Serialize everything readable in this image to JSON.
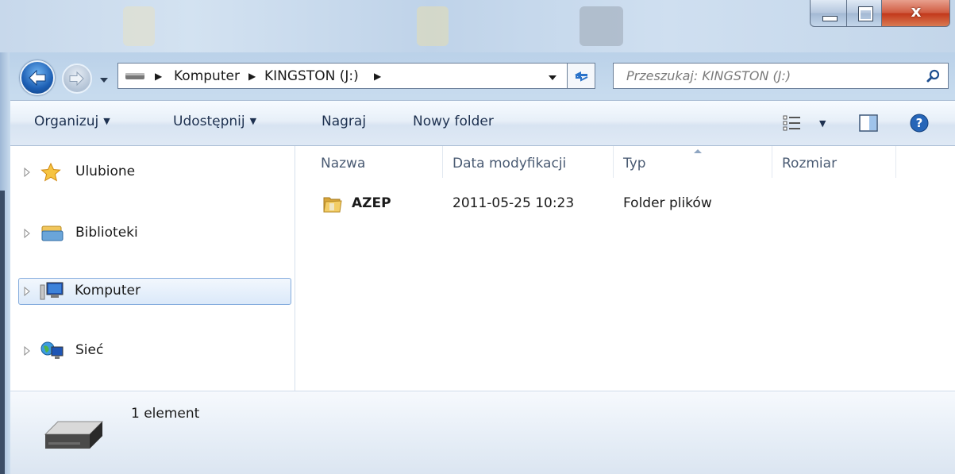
{
  "window": {
    "close_glyph": "x"
  },
  "address": {
    "crumbs": [
      "Komputer",
      "KINGSTON (J:)"
    ]
  },
  "search": {
    "placeholder": "Przeszukaj: KINGSTON (J:)"
  },
  "toolbar": {
    "organize": "Organizuj",
    "share": "Udostępnij",
    "burn": "Nagraj",
    "new_folder": "Nowy folder"
  },
  "nav": {
    "items": [
      {
        "label": "Ulubione",
        "icon": "star-icon"
      },
      {
        "label": "Biblioteki",
        "icon": "libraries-icon"
      },
      {
        "label": "Komputer",
        "icon": "computer-icon",
        "selected": true
      },
      {
        "label": "Sieć",
        "icon": "network-icon"
      }
    ]
  },
  "columns": {
    "name": "Nazwa",
    "date": "Data modyfikacji",
    "type": "Typ",
    "size": "Rozmiar"
  },
  "files": [
    {
      "name": "AZEP",
      "date": "2011-05-25 10:23",
      "type": "Folder plików",
      "size": "",
      "icon": "folder-icon"
    }
  ],
  "details": {
    "count": "1 element"
  },
  "colors": {
    "accent": "#1d5fb4",
    "toolbar_text": "#1e3150",
    "selection_border": "#84acdd",
    "close_red": "#c2371a"
  }
}
